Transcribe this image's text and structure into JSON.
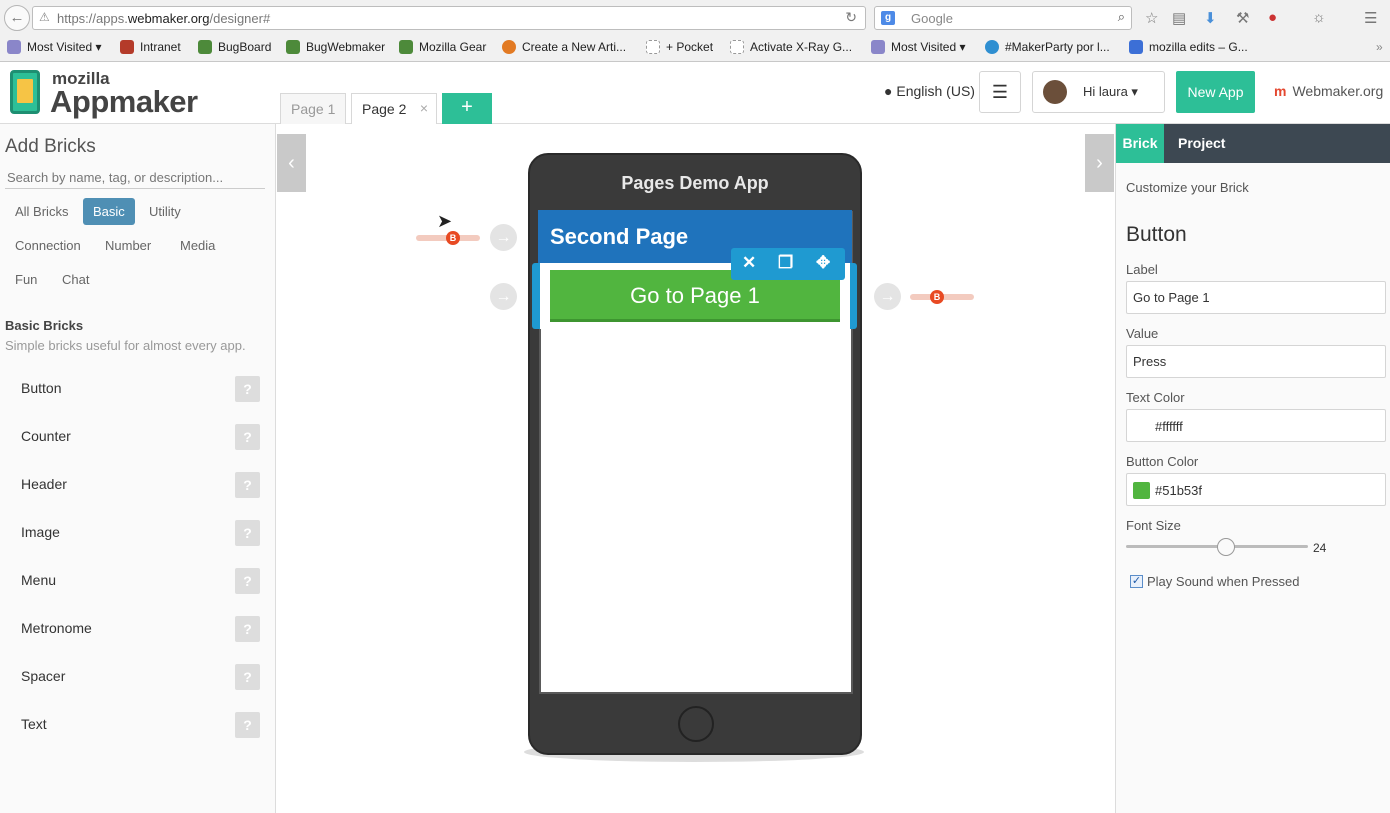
{
  "browser": {
    "url_prefix": "https://apps.",
    "url_domain": "webmaker.org",
    "url_suffix": "/designer#",
    "search_placeholder": "Google",
    "bookmarks": [
      {
        "label": "Most Visited ▾",
        "color": "#8a86c9"
      },
      {
        "label": "Intranet",
        "color": "#b43b2a"
      },
      {
        "label": "BugBoard",
        "color": "#4d8a3a"
      },
      {
        "label": "BugWebmaker",
        "color": "#4d8a3a"
      },
      {
        "label": "Mozilla Gear",
        "color": "#4d8a3a"
      },
      {
        "label": "Create a New Arti...",
        "color": "#e27a23"
      },
      {
        "label": "+ Pocket",
        "color": "#cccccc"
      },
      {
        "label": "Activate X-Ray G...",
        "color": "#cccccc"
      },
      {
        "label": "Most Visited ▾",
        "color": "#8a86c9"
      },
      {
        "label": "#MakerParty por l...",
        "color": "#2f8fd1"
      },
      {
        "label": "mozilla edits – G...",
        "color": "#3c6fd6"
      }
    ]
  },
  "header": {
    "logo_small": "mozilla",
    "logo_big": "Appmaker",
    "pages": [
      "Page 1",
      "Page 2"
    ],
    "add_page": "+",
    "language": "English (US)",
    "greeting": "Hi laura",
    "new_app": "New App",
    "webmaker": "Webmaker.org"
  },
  "left": {
    "title": "Add Bricks",
    "search_placeholder": "Search by name, tag, or description...",
    "categories": [
      "All Bricks",
      "Basic",
      "Utility",
      "Connection",
      "Number",
      "Media",
      "Fun",
      "Chat"
    ],
    "section_title": "Basic Bricks",
    "section_sub": "Simple bricks useful for almost every app.",
    "bricks": [
      "Button",
      "Counter",
      "Header",
      "Image",
      "Menu",
      "Metronome",
      "Spacer",
      "Text"
    ],
    "help": "?"
  },
  "canvas": {
    "app_title": "Pages Demo App",
    "page_header": "Second Page",
    "button_label": "Go to Page 1",
    "wire_badge": "B"
  },
  "right": {
    "tabs": [
      "Brick",
      "Project"
    ],
    "customize": "Customize your Brick",
    "brick_name": "Button",
    "label_label": "Label",
    "label_value": "Go to Page 1",
    "value_label": "Value",
    "value_value": "Press",
    "text_color_label": "Text Color",
    "text_color": "#ffffff",
    "button_color_label": "Button Color",
    "button_color": "#51b53f",
    "font_size_label": "Font Size",
    "font_size": "24",
    "play_sound_label": "Play Sound when Pressed",
    "play_sound_checked": true
  },
  "colors": {
    "accent": "#2dbf97",
    "selection": "#1f9ad1",
    "page_header": "#1f73bc",
    "button": "#51b53f"
  }
}
